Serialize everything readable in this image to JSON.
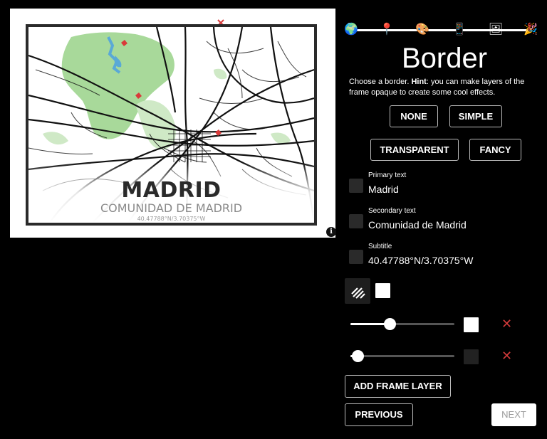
{
  "preview": {
    "map_title": "MADRID",
    "map_secondary": "COMUNIDAD DE MADRID",
    "map_subtitle": "40.47788°N/3.70375°W",
    "info_icon": "info-icon",
    "colors": {
      "park": "#a8d99a",
      "water": "#5aa9d6",
      "roads": "#111111",
      "frame": "#2a2a2a",
      "pin": "#d93a3a"
    }
  },
  "steps": {
    "icons": [
      "globe-icon",
      "pin-icon",
      "palette-icon",
      "phone-icon",
      "frame-icon",
      "party-popper-icon"
    ],
    "glyphs": [
      "🌍",
      "📍",
      "🎨",
      "📱",
      "🖼",
      "🎉"
    ],
    "active_index": 4
  },
  "panel": {
    "heading": "Border",
    "hint_lead": "Choose a border. ",
    "hint_bold": "Hint",
    "hint_rest": ": you can make layers of the frame opaque to create some cool effects.",
    "border_buttons": {
      "none": "NONE",
      "simple": "SIMPLE",
      "transparent": "TRANSPARENT",
      "fancy": "FANCY"
    },
    "text_rows": [
      {
        "label": "Primary text",
        "value": "Madrid"
      },
      {
        "label": "Secondary text",
        "value": "Comunidad de Madrid"
      },
      {
        "label": "Subtitle",
        "value": "40.47788°N/3.70375°W"
      }
    ],
    "layers": [
      {
        "level": 0.38,
        "color": "#ffffff"
      },
      {
        "level": 0.07,
        "color": "#222222"
      }
    ],
    "add_layer_label": "ADD FRAME LAYER",
    "previous_label": "PREVIOUS",
    "next_label": "NEXT"
  }
}
